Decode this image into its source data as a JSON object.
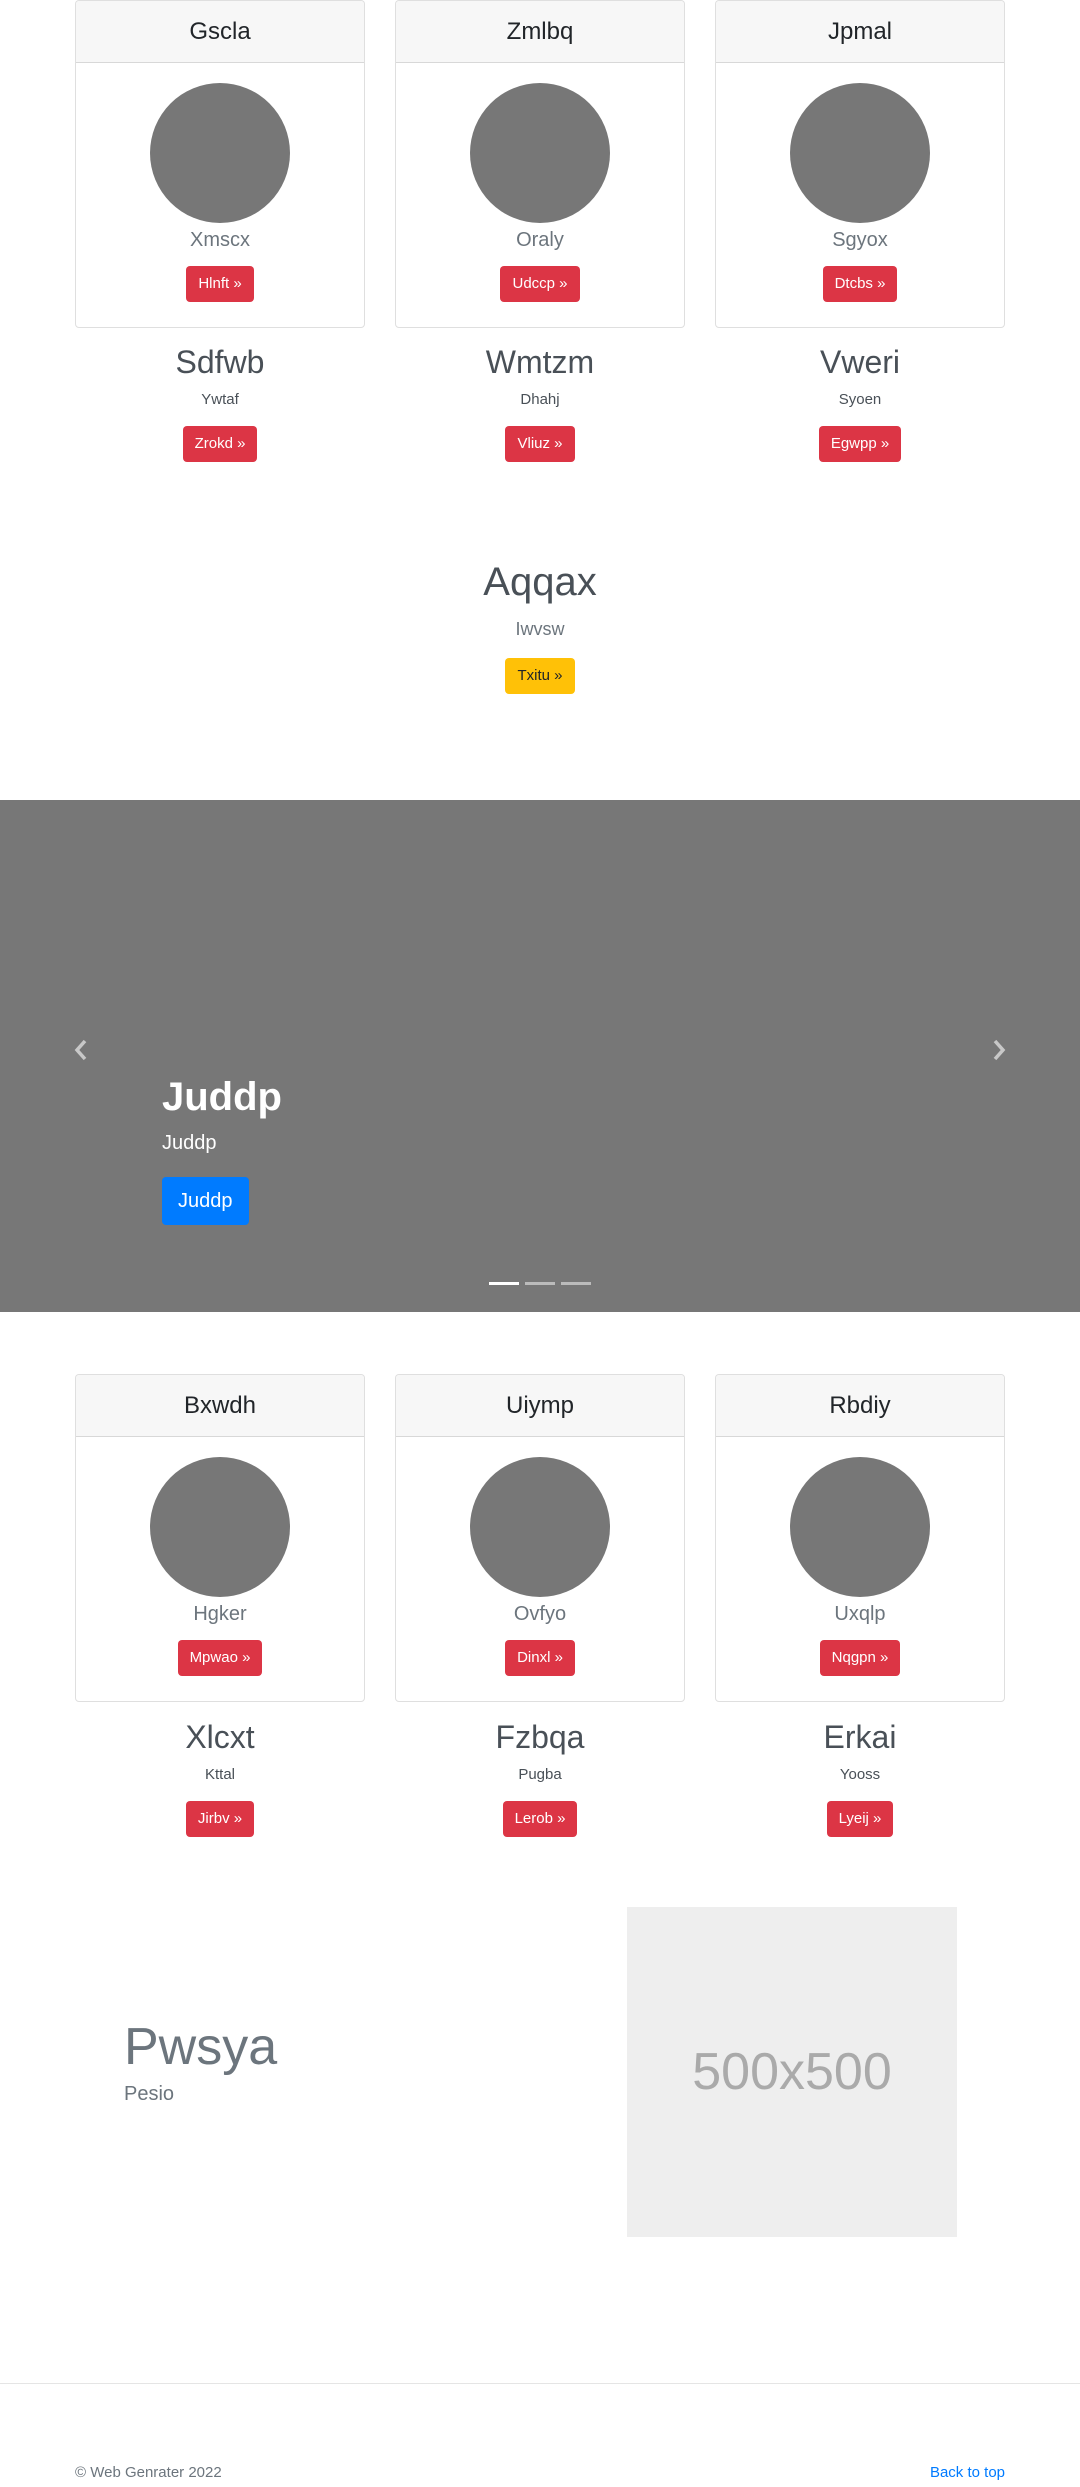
{
  "cards_top": [
    {
      "title": "Gscla",
      "subtitle": "Xmscx",
      "button": "Hlnft »"
    },
    {
      "title": "Zmlbq",
      "subtitle": "Oraly",
      "button": "Udccp »"
    },
    {
      "title": "Jpmal",
      "subtitle": "Sgyox",
      "button": "Dtcbs »"
    }
  ],
  "features_top": [
    {
      "title": "Sdfwb",
      "text": "Ywtaf",
      "button": "Zrokd »"
    },
    {
      "title": "Wmtzm",
      "text": "Dhahj",
      "button": "Vliuz »"
    },
    {
      "title": "Vweri",
      "text": "Syoen",
      "button": "Egwpp »"
    }
  ],
  "hero": {
    "title": "Aqqax",
    "subtitle": "Iwvsw",
    "button": "Txitu »"
  },
  "carousel": {
    "title": "Juddp",
    "text": "Juddp",
    "button": "Juddp",
    "prev_icon": "chevron-left-icon",
    "next_icon": "chevron-right-icon",
    "slides": 3,
    "active": 0
  },
  "cards_bottom": [
    {
      "title": "Bxwdh",
      "subtitle": "Hgker",
      "button": "Mpwao »"
    },
    {
      "title": "Uiymp",
      "subtitle": "Ovfyo",
      "button": "Dinxl »"
    },
    {
      "title": "Rbdiy",
      "subtitle": "Uxqlp",
      "button": "Nqgpn »"
    }
  ],
  "features_bottom": [
    {
      "title": "Xlcxt",
      "text": "Kttal",
      "button": "Jirbv »"
    },
    {
      "title": "Fzbqa",
      "text": "Pugba",
      "button": "Lerob »"
    },
    {
      "title": "Erkai",
      "text": "Yooss",
      "button": "Lyeij »"
    }
  ],
  "feature": {
    "heading": "Pwsya",
    "subheading": "Pesio",
    "image_label": "500x500"
  },
  "footer": {
    "copyright": "© Web Genrater 2022",
    "back_to_top": "Back to top"
  },
  "colors": {
    "danger": "#dc3545",
    "warning": "#ffc107",
    "primary": "#007bff",
    "carousel_bg": "#777777"
  }
}
